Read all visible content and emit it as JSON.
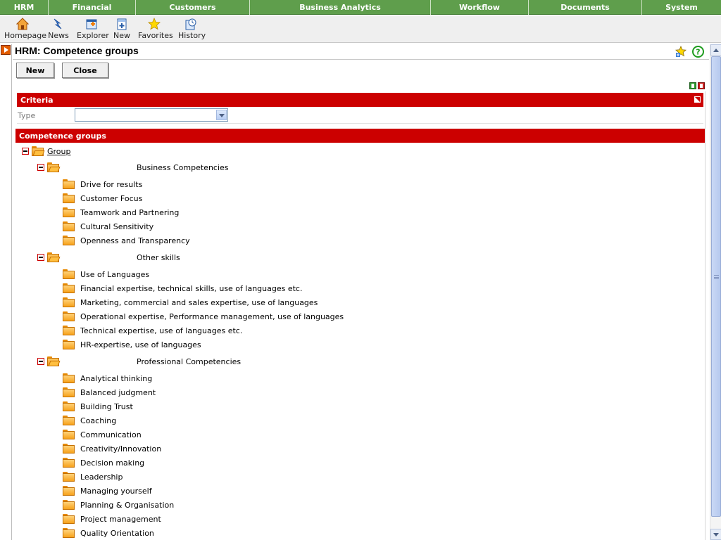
{
  "menu": [
    {
      "label": "HRM"
    },
    {
      "label": "Financial"
    },
    {
      "label": "Customers"
    },
    {
      "label": "Business Analytics"
    },
    {
      "label": "Workflow"
    },
    {
      "label": "Documents"
    },
    {
      "label": "System"
    }
  ],
  "toolbar": {
    "homepage": "Homepage",
    "news": "News",
    "explorer": "Explorer",
    "new": "New",
    "favorites": "Favorites",
    "history": "History"
  },
  "page": {
    "title": "HRM: Competence groups"
  },
  "actions": {
    "new_label": "New",
    "close_label": "Close"
  },
  "criteria": {
    "header": "Criteria",
    "type_label": "Type",
    "type_value": ""
  },
  "groups": {
    "header": "Competence groups",
    "root_label": "Group",
    "categories": [
      {
        "name": "Business Competencies",
        "items": [
          "Drive for results",
          "Customer Focus",
          "Teamwork and Partnering",
          "Cultural Sensitivity",
          "Openness and Transparency"
        ]
      },
      {
        "name": "Other skills",
        "items": [
          "Use of Languages",
          "Financial expertise, technical skills, use of languages etc.",
          "Marketing, commercial and sales expertise, use of languages",
          "Operational expertise, Performance management, use of languages",
          "Technical expertise, use of languages etc.",
          "HR-expertise, use of languages"
        ]
      },
      {
        "name": "Professional Competencies",
        "items": [
          "Analytical thinking",
          "Balanced judgment",
          "Building Trust",
          "Coaching",
          "Communication",
          "Creativity/Innovation",
          "Decision making",
          "Leadership",
          "Managing yourself",
          "Planning & Organisation",
          "Project management",
          "Quality Orientation"
        ]
      }
    ]
  },
  "colors": {
    "menu_green": "#5f9e4c",
    "section_red": "#cc0000"
  }
}
